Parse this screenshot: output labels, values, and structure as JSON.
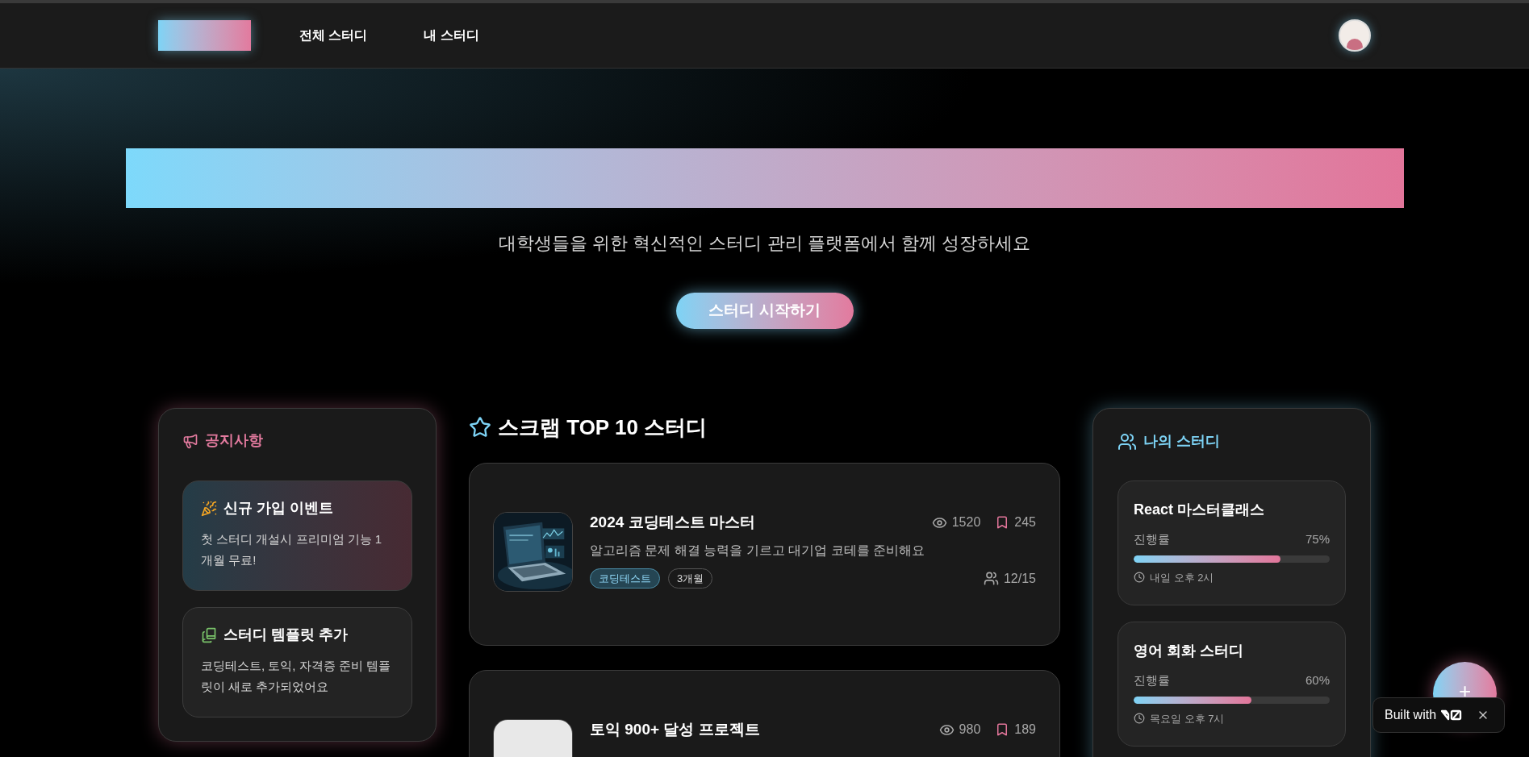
{
  "nav": {
    "links": [
      {
        "label": "전체 스터디"
      },
      {
        "label": "내 스터디"
      }
    ]
  },
  "hero": {
    "subtitle": "대학생들을 위한 혁신적인 스터디 관리 플랫폼에서 함께 성장하세요",
    "cta": "스터디 시작하기"
  },
  "notices": {
    "title": "공지사항",
    "items": [
      {
        "kind": "event",
        "highlighted": true,
        "title": "신규 가입 이벤트",
        "body": "첫 스터디 개설시 프리미엄 기능 1개월 무료!"
      },
      {
        "kind": "template",
        "highlighted": false,
        "title": "스터디 템플릿 추가",
        "body": "코딩테스트, 토익, 자격증 준비 템플릿이 새로 추가되었어요"
      }
    ]
  },
  "top": {
    "title": "스크랩 TOP 10 스터디",
    "studies": [
      {
        "title": "2024 코딩테스트 마스터",
        "views": "1520",
        "scraps": "245",
        "description": "알고리즘 문제 해결 능력을 기르고 대기업 코테를 준비해요",
        "category": "코딩테스트",
        "duration": "3개월",
        "members": "12/15",
        "kind": "picture"
      },
      {
        "title": "토익 900+ 달성 프로젝트",
        "views": "980",
        "scraps": "189",
        "kind": "placeholder"
      }
    ]
  },
  "my_studies": {
    "title": "나의 스터디",
    "items": [
      {
        "name": "React 마스터클래스",
        "progress_label": "진행률",
        "percent": "75%",
        "level": 0.75,
        "schedule": "내일 오후 2시"
      },
      {
        "name": "영어 회화 스터디",
        "progress_label": "진행률",
        "percent": "60%",
        "level": 0.6,
        "schedule": "목요일 오후 7시"
      }
    ]
  },
  "fab": {
    "label": "+"
  },
  "badge": {
    "text": "Built with"
  }
}
